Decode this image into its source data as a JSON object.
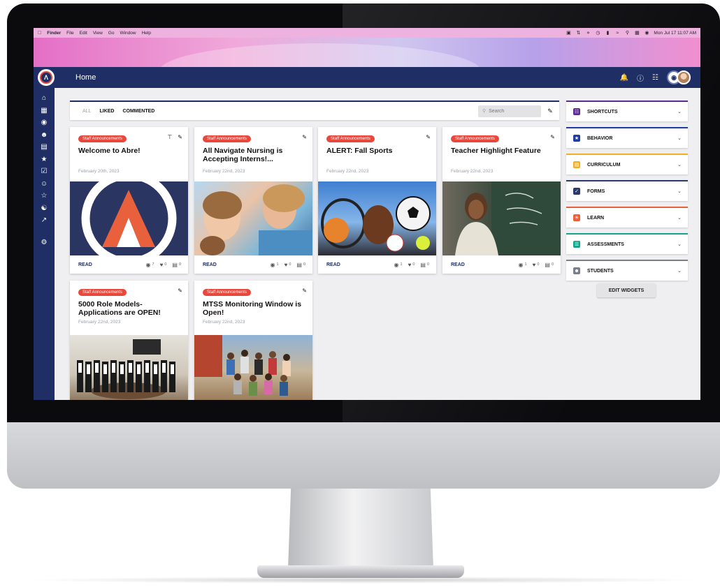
{
  "menubar": {
    "items": [
      "Finder",
      "File",
      "Edit",
      "View",
      "Go",
      "Window",
      "Help"
    ],
    "clock": "Mon Jul 17  11:07 AM"
  },
  "app": {
    "page_title": "Home"
  },
  "toolbar": {
    "filters": [
      "ALL",
      "LIKED",
      "COMMENTED"
    ],
    "search_placeholder": "Search"
  },
  "cards": [
    {
      "badge": "Staff Announcements",
      "title": "Welcome to Abre!",
      "date": "February 20th, 2023",
      "read": "READ",
      "views": "7",
      "likes": "0",
      "comments": "0",
      "pinned": true
    },
    {
      "badge": "Staff Announcements",
      "title": "All Navigate Nursing is Accepting Interns!...",
      "date": "February 22nd, 2023",
      "read": "READ",
      "views": "1",
      "likes": "0",
      "comments": "0",
      "pinned": false
    },
    {
      "badge": "Staff Announcements",
      "title": "ALERT: Fall Sports",
      "date": "February 22nd, 2023",
      "read": "READ",
      "views": "1",
      "likes": "0",
      "comments": "0",
      "pinned": false
    },
    {
      "badge": "Staff Announcements",
      "title": "Teacher Highlight Feature",
      "date": "February 22nd, 2023",
      "read": "READ",
      "views": "1",
      "likes": "0",
      "comments": "0",
      "pinned": false
    },
    {
      "badge": "Staff Announcements",
      "title": "5000 Role Models-Applications are OPEN!",
      "date": "February 22nd, 2023"
    },
    {
      "badge": "Staff Announcements",
      "title": "MTSS Monitoring Window is Open!",
      "date": "February 22nd, 2023"
    }
  ],
  "widgets": [
    {
      "label": "SHORTCUTS",
      "color": "#5b2d91",
      "icon": "grid-icon"
    },
    {
      "label": "BEHAVIOR",
      "color": "#1f3c9e",
      "icon": "star-person-icon"
    },
    {
      "label": "CURRICULUM",
      "color": "#f2b01e",
      "icon": "book-icon"
    },
    {
      "label": "FORMS",
      "color": "#2b3a67",
      "icon": "checklist-icon"
    },
    {
      "label": "LEARN",
      "color": "#e8603c",
      "icon": "lightbulb-icon"
    },
    {
      "label": "ASSESSMENTS",
      "color": "#17a38a",
      "icon": "list-icon"
    },
    {
      "label": "STUDENTS",
      "color": "#7a7f89",
      "icon": "people-icon"
    }
  ],
  "edit_widgets_label": "EDIT WIDGETS",
  "colors": {
    "navy": "#1f2f66",
    "badge_red": "#e8473c"
  }
}
